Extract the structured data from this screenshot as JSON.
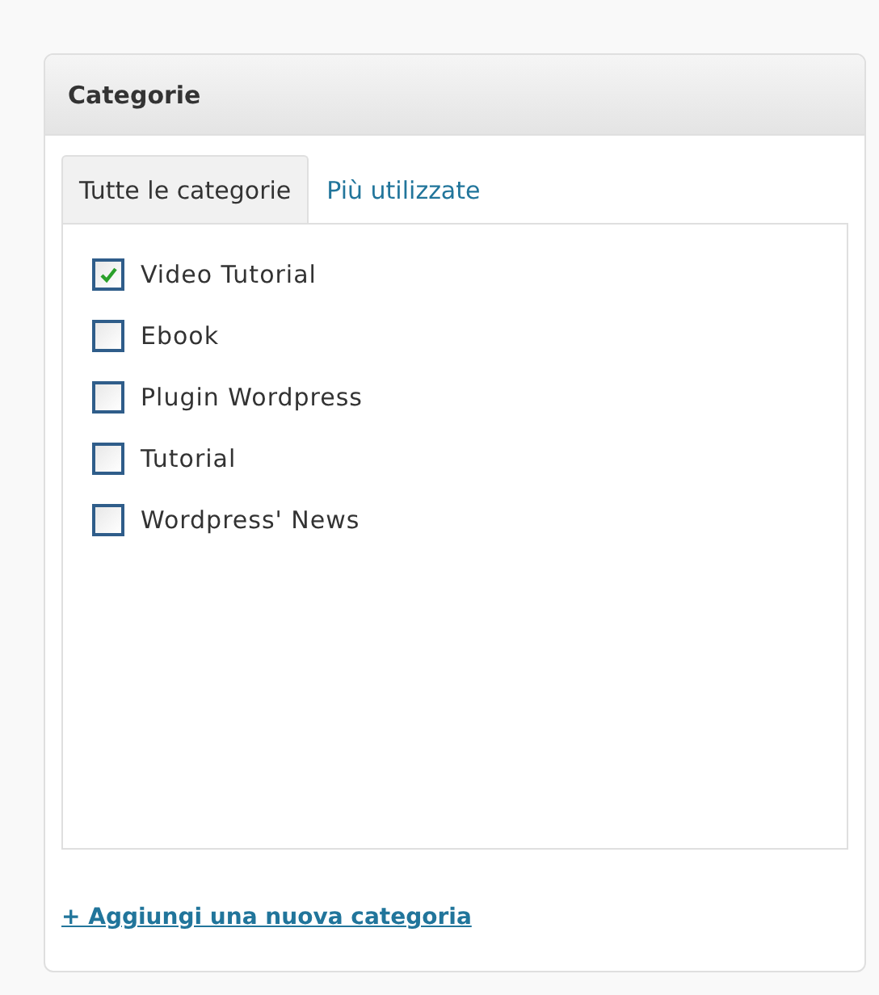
{
  "box": {
    "title": "Categorie"
  },
  "tabs": [
    {
      "label": "Tutte le categorie",
      "selected": true
    },
    {
      "label": "Più utilizzate",
      "selected": false
    }
  ],
  "categories": [
    {
      "label": "Video Tutorial",
      "checked": true
    },
    {
      "label": "Ebook",
      "checked": false
    },
    {
      "label": "Plugin Wordpress",
      "checked": false
    },
    {
      "label": "Tutorial",
      "checked": false
    },
    {
      "label": "Wordpress' News",
      "checked": false
    }
  ],
  "add_link": "+ Aggiungi una nuova categoria"
}
